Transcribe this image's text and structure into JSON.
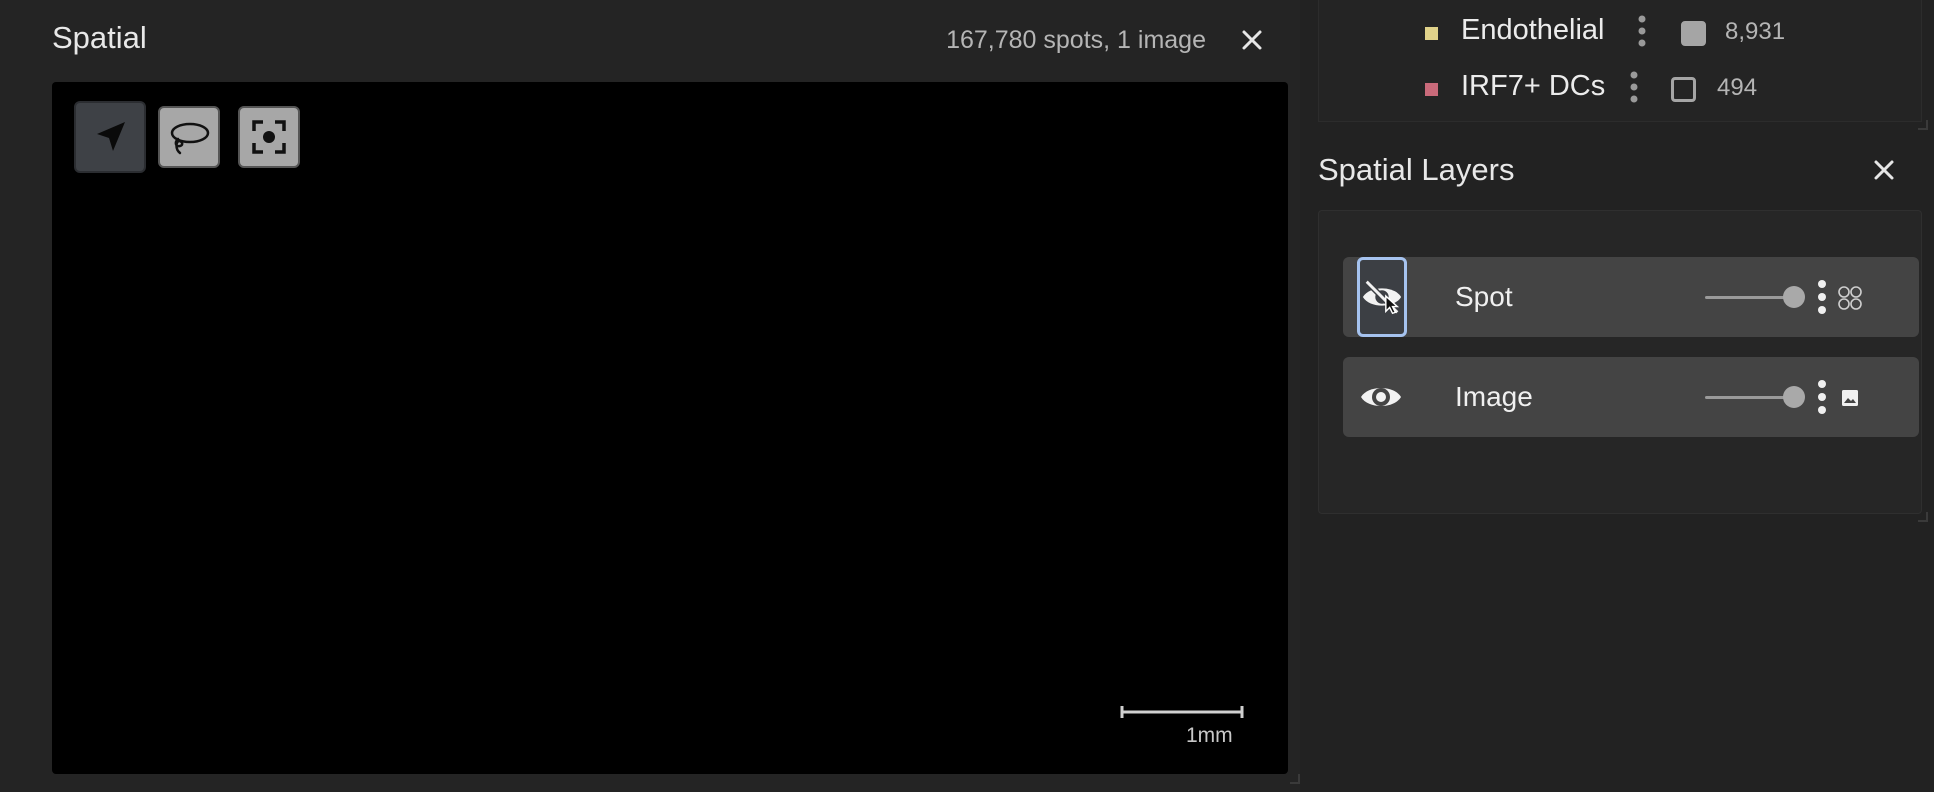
{
  "spatial": {
    "title": "Spatial",
    "info": "167,780 spots, 1 image",
    "tools": [
      {
        "name": "pointer-tool",
        "icon": "navigation-arrow-icon",
        "active": true
      },
      {
        "name": "lasso-tool",
        "icon": "lasso-icon",
        "active": false
      },
      {
        "name": "recenter-tool",
        "icon": "center-focus-icon",
        "active": false
      }
    ],
    "scalebar_label": "1mm"
  },
  "legend": {
    "items": [
      {
        "name": "Endothelial",
        "color": "#e0d28a",
        "count": "8,931",
        "checked": true
      },
      {
        "name": "IRF7+ DCs",
        "color": "#c96a7a",
        "count": "494",
        "checked": false
      }
    ]
  },
  "layers": {
    "title": "Spatial Layers",
    "items": [
      {
        "name": "Spot",
        "visible": false,
        "opacity": 1.0,
        "type_icon": "spots-grid-icon"
      },
      {
        "name": "Image",
        "visible": true,
        "opacity": 1.0,
        "type_icon": "image-icon"
      }
    ]
  },
  "colors": {
    "background": "#222222",
    "viewport": "#000000",
    "layer_row": "#444444",
    "focus_ring": "#a6c3ef"
  }
}
